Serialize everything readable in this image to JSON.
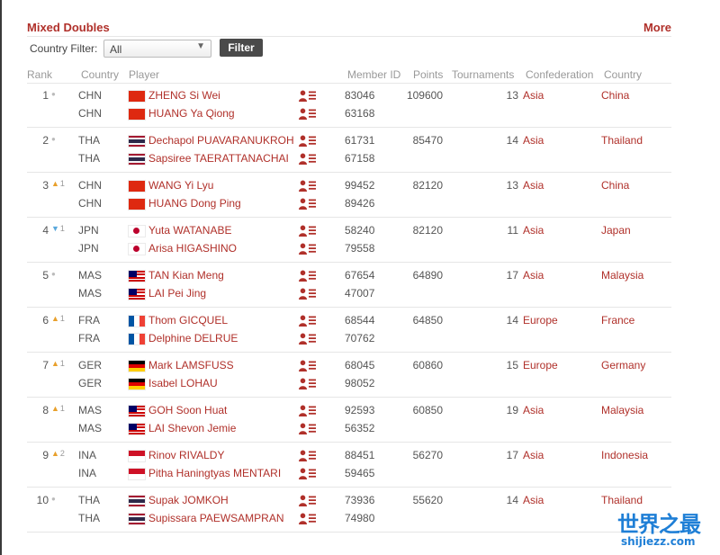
{
  "section": {
    "title": "Mixed Doubles",
    "more_label": "More"
  },
  "filter": {
    "label": "Country Filter:",
    "selected": "All",
    "button": "Filter"
  },
  "columns": {
    "rank": "Rank",
    "country": "Country",
    "player": "Player",
    "member_id": "Member ID",
    "points": "Points",
    "tournaments": "Tournaments",
    "confederation": "Confederation",
    "country_name": "Country"
  },
  "flags": {
    "CHN": [
      "#de2910"
    ],
    "THA": [
      "#a51931",
      "#f4f5f8",
      "#2d2a4a",
      "#2d2a4a",
      "#f4f5f8",
      "#a51931"
    ],
    "JPN": [
      "#ffffff"
    ],
    "MAS": [
      "#cc0001",
      "#ffffff",
      "#cc0001",
      "#ffffff",
      "#cc0001",
      "#ffffff",
      "#cc0001"
    ],
    "FRA": [
      "#0055a4",
      "#ffffff",
      "#ef4135"
    ],
    "GER": [
      "#000000",
      "#dd0000",
      "#ffce00"
    ],
    "INA": [
      "#ce1126",
      "#ffffff"
    ]
  },
  "colors": {
    "accent": "#b0302a",
    "move_up": "#e8a02c",
    "move_down": "#5aa8dc"
  },
  "rows": [
    {
      "rank": "1",
      "move": "none",
      "move_n": "",
      "points": "109600",
      "tournaments": "13",
      "confederation": "Asia",
      "country_name": "China",
      "players": [
        {
          "country": "CHN",
          "name": "ZHENG Si Wei",
          "member_id": "83046"
        },
        {
          "country": "CHN",
          "name": "HUANG Ya Qiong",
          "member_id": "63168"
        }
      ]
    },
    {
      "rank": "2",
      "move": "none",
      "move_n": "",
      "points": "85470",
      "tournaments": "14",
      "confederation": "Asia",
      "country_name": "Thailand",
      "players": [
        {
          "country": "THA",
          "name": "Dechapol PUAVARANUKROH",
          "member_id": "61731"
        },
        {
          "country": "THA",
          "name": "Sapsiree TAERATTANACHAI",
          "member_id": "67158"
        }
      ]
    },
    {
      "rank": "3",
      "move": "up",
      "move_n": "1",
      "points": "82120",
      "tournaments": "13",
      "confederation": "Asia",
      "country_name": "China",
      "players": [
        {
          "country": "CHN",
          "name": "WANG Yi Lyu",
          "member_id": "99452"
        },
        {
          "country": "CHN",
          "name": "HUANG Dong Ping",
          "member_id": "89426"
        }
      ]
    },
    {
      "rank": "4",
      "move": "down",
      "move_n": "1",
      "points": "82120",
      "tournaments": "11",
      "confederation": "Asia",
      "country_name": "Japan",
      "players": [
        {
          "country": "JPN",
          "name": "Yuta WATANABE",
          "member_id": "58240"
        },
        {
          "country": "JPN",
          "name": "Arisa HIGASHINO",
          "member_id": "79558"
        }
      ]
    },
    {
      "rank": "5",
      "move": "none",
      "move_n": "",
      "points": "64890",
      "tournaments": "17",
      "confederation": "Asia",
      "country_name": "Malaysia",
      "players": [
        {
          "country": "MAS",
          "name": "TAN Kian Meng",
          "member_id": "67654"
        },
        {
          "country": "MAS",
          "name": "LAI Pei Jing",
          "member_id": "47007"
        }
      ]
    },
    {
      "rank": "6",
      "move": "up",
      "move_n": "1",
      "points": "64850",
      "tournaments": "14",
      "confederation": "Europe",
      "country_name": "France",
      "players": [
        {
          "country": "FRA",
          "name": "Thom GICQUEL",
          "member_id": "68544"
        },
        {
          "country": "FRA",
          "name": "Delphine DELRUE",
          "member_id": "70762"
        }
      ]
    },
    {
      "rank": "7",
      "move": "up",
      "move_n": "1",
      "points": "60860",
      "tournaments": "15",
      "confederation": "Europe",
      "country_name": "Germany",
      "players": [
        {
          "country": "GER",
          "name": "Mark LAMSFUSS",
          "member_id": "68045"
        },
        {
          "country": "GER",
          "name": "Isabel LOHAU",
          "member_id": "98052"
        }
      ]
    },
    {
      "rank": "8",
      "move": "up",
      "move_n": "1",
      "points": "60850",
      "tournaments": "19",
      "confederation": "Asia",
      "country_name": "Malaysia",
      "players": [
        {
          "country": "MAS",
          "name": "GOH Soon Huat",
          "member_id": "92593"
        },
        {
          "country": "MAS",
          "name": "LAI Shevon Jemie",
          "member_id": "56352"
        }
      ]
    },
    {
      "rank": "9",
      "move": "up",
      "move_n": "2",
      "points": "56270",
      "tournaments": "17",
      "confederation": "Asia",
      "country_name": "Indonesia",
      "players": [
        {
          "country": "INA",
          "name": "Rinov RIVALDY",
          "member_id": "88451"
        },
        {
          "country": "INA",
          "name": "Pitha Haningtyas MENTARI",
          "member_id": "59465"
        }
      ]
    },
    {
      "rank": "10",
      "move": "none",
      "move_n": "",
      "points": "55620",
      "tournaments": "14",
      "confederation": "Asia",
      "country_name": "Thailand",
      "players": [
        {
          "country": "THA",
          "name": "Supak JOMKOH",
          "member_id": "73936"
        },
        {
          "country": "THA",
          "name": "Supissara PAEWSAMPRAN",
          "member_id": "74980"
        }
      ]
    }
  ],
  "watermark": {
    "cn": "世界之最",
    "en": "shijiezz.com"
  }
}
